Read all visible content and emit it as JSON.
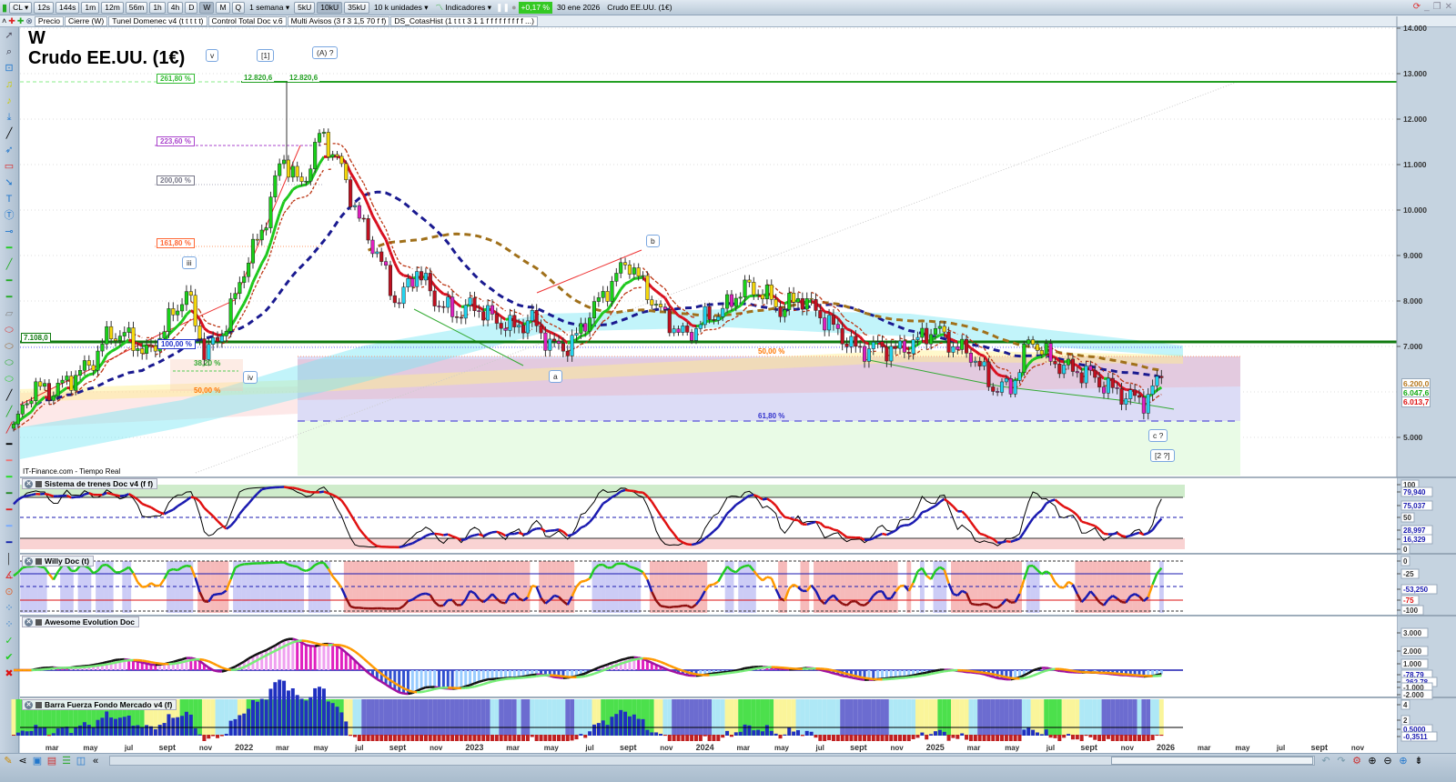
{
  "toolbar": {
    "symbol": "CL",
    "intervals": [
      "12s",
      "144s",
      "1m",
      "12m",
      "56m",
      "1h",
      "4h",
      "D",
      "W",
      "M",
      "Q"
    ],
    "active_interval": "W",
    "period": "1 semana",
    "units": [
      "5kU",
      "10kU",
      "35kU"
    ],
    "active_unit": "10kU",
    "units_select": "10 k unidades",
    "indicators_label": "Indicadores",
    "change_pct": "+0,17 %",
    "date": "30 ene 2026",
    "instrument": "Crudo EE.UU. (1€)"
  },
  "overlays": [
    "Precio",
    "Cierre (W)",
    "Tunel Domenec v4 (t t t t t)",
    "Control Total Doc v.6",
    "Multi Avisos (3 f 3 1,5 70 f f)",
    "DS_CotasHist (1 t t t 3 1 1 f f f f f f f f f ...)"
  ],
  "chart": {
    "interval_label": "W",
    "title": "Crudo EE.UU. (1€)",
    "source": "IT-Finance.com - Tiempo Real",
    "wave_labels": [
      "v",
      "[1]",
      "(A) ?",
      "iii",
      "iv",
      "b",
      "a",
      "c ?",
      "[2 ?]"
    ],
    "fib_labels": [
      "261,80 %",
      "223,60 %",
      "200,00 %",
      "161,80 %",
      "100,00 %",
      "38,20 %",
      "50,00 %",
      "50,00 %",
      "61,80 %"
    ],
    "level_labels": [
      "12.820,6",
      "12.820,6",
      "7.108,0"
    ],
    "price_axis": [
      "14.000",
      "13.000",
      "12.000",
      "11.000",
      "10.000",
      "9.000",
      "8.000",
      "7.000",
      "5.000"
    ],
    "price_tags": [
      "6.200,0",
      "6.047,6",
      "6.013,7"
    ],
    "colors": {
      "up": "#19d119",
      "down": "#d81020",
      "resistance": "#23a023",
      "support": "#0f7a0f"
    }
  },
  "panels": [
    {
      "title": "Sistema de trenes Doc v4 (f f)",
      "axis": [
        "100",
        "79,940",
        "75,037",
        "50",
        "28,997",
        "16,329",
        "0"
      ]
    },
    {
      "title": "Willy Doc (t)",
      "axis": [
        "0",
        "-25",
        "-53,250",
        "-75",
        "-100"
      ]
    },
    {
      "title": "Awesome Evolution Doc",
      "axis": [
        "3.000",
        "2.000",
        "1.000",
        "-78,79",
        "-262,78",
        "-1.000",
        "-2.000"
      ]
    },
    {
      "title": "Barra Fuerza Fondo Mercado v4 (f)",
      "axis": [
        "4",
        "2",
        "0,5000",
        "-0,3511"
      ]
    }
  ],
  "time_axis": [
    "mar",
    "may",
    "jul",
    "sept",
    "nov",
    "2022",
    "mar",
    "may",
    "jul",
    "sept",
    "nov",
    "2023",
    "mar",
    "may",
    "jul",
    "sept",
    "nov",
    "2024",
    "mar",
    "may",
    "jul",
    "sept",
    "nov",
    "2025",
    "mar",
    "may",
    "jul",
    "sept",
    "nov",
    "2026",
    "mar",
    "may",
    "jul",
    "sept",
    "nov"
  ],
  "chart_data": {
    "type": "candlestick",
    "title": "Crudo EE.UU. (1€)",
    "interval": "weekly",
    "start_month": "2021-01",
    "monthly_close": [
      5200,
      6100,
      6000,
      6300,
      6600,
      7300,
      7200,
      6800,
      7500,
      8200,
      6800,
      7400,
      8700,
      9600,
      11200,
      10500,
      11700,
      11000,
      9800,
      9000,
      7900,
      8700,
      8000,
      7700,
      7900,
      7600,
      7400,
      7600,
      7000,
      7000,
      7700,
      8300,
      8900,
      8200,
      7600,
      7200,
      7600,
      7800,
      8300,
      8200,
      7800,
      8100,
      7700,
      7300,
      6900,
      7000,
      6900,
      7100,
      7400,
      7000,
      6800,
      6100,
      6100,
      7200,
      6700,
      6500,
      6400,
      6100,
      5900,
      5800,
      6500
    ],
    "peak": 12820.6,
    "support": 7108.0,
    "ylim": [
      4400,
      14300
    ]
  }
}
